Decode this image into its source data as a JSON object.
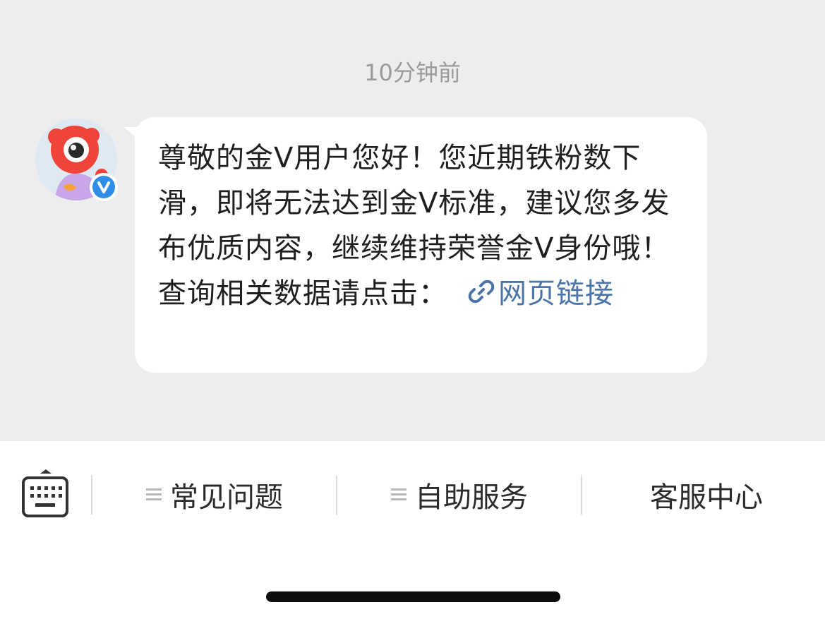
{
  "chat": {
    "timestamp": "10分钟前",
    "sender": {
      "avatar_icon": "weibo-mascot-icon",
      "badge_icon": "verified-v-icon",
      "badge_color": "#2f8ee8"
    },
    "message": {
      "text": "尊敬的金Ⅴ用户您好！您近期铁粉数下滑，即将无法达到金Ⅴ标准，建议您多发布优质内容，继续维持荣誉金Ⅴ身份哦！ 查询相关数据请点击：",
      "link_label": "网页链接",
      "link_icon": "link-icon",
      "link_color": "#4a74a8"
    }
  },
  "toolbar": {
    "keyboard_icon": "keyboard-icon",
    "items": [
      {
        "label": "常见问题",
        "icon": "menu-icon"
      },
      {
        "label": "自助服务",
        "icon": "menu-icon"
      },
      {
        "label": "客服中心"
      }
    ]
  },
  "colors": {
    "chat_background": "#ededed",
    "bubble_background": "#ffffff",
    "text": "#1f1f1f"
  }
}
